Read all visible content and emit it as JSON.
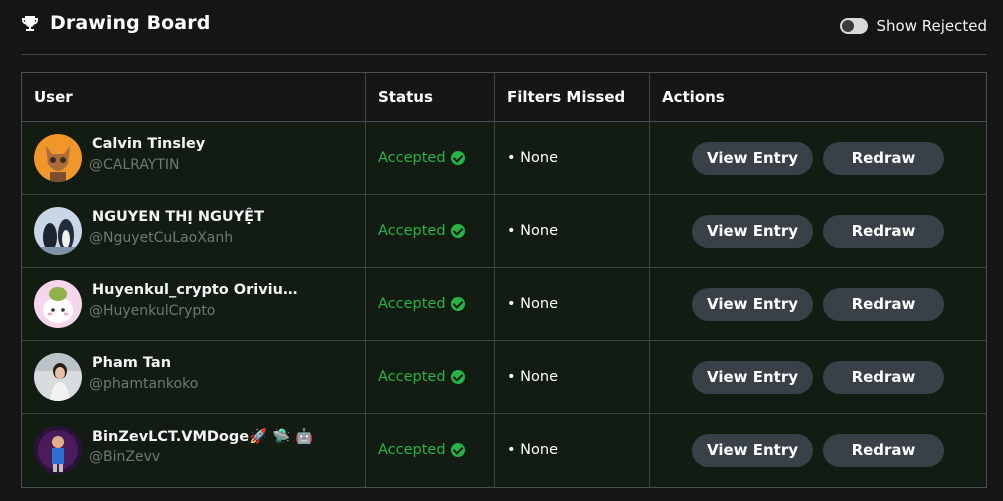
{
  "header": {
    "title": "Drawing Board",
    "toggle_label": "Show Rejected",
    "toggle_on": false
  },
  "table": {
    "columns": [
      "User",
      "Status",
      "Filters Missed",
      "Actions"
    ],
    "rows": [
      {
        "name": "Calvin Tinsley",
        "handle": "@CALRAYTIN",
        "status": "Accepted",
        "filters": "• None",
        "view": "View Entry",
        "redraw": "Redraw"
      },
      {
        "name": "NGUYEN THỊ NGUYỆT",
        "handle": "@NguyetCuLaoXanh",
        "status": "Accepted",
        "filters": "• None",
        "view": "View Entry",
        "redraw": "Redraw"
      },
      {
        "name": "Huyenkul_crypto Oriviu…",
        "handle": "@HuyenkulCrypto",
        "status": "Accepted",
        "filters": "• None",
        "view": "View Entry",
        "redraw": "Redraw"
      },
      {
        "name": "Pham Tan",
        "handle": "@phamtankoko",
        "status": "Accepted",
        "filters": "• None",
        "view": "View Entry",
        "redraw": "Redraw"
      },
      {
        "name": "BinZevLCT.VMDoge🚀 🛸 🤖",
        "handle": "@BinZevv",
        "status": "Accepted",
        "filters": "• None",
        "view": "View Entry",
        "redraw": "Redraw"
      }
    ]
  },
  "colors": {
    "accepted": "#27b346",
    "button_bg": "#394048",
    "page_bg": "#151515",
    "row_bg": "#131c13"
  },
  "icons": {
    "header": "trophy-icon",
    "status": "check-circle-icon"
  }
}
